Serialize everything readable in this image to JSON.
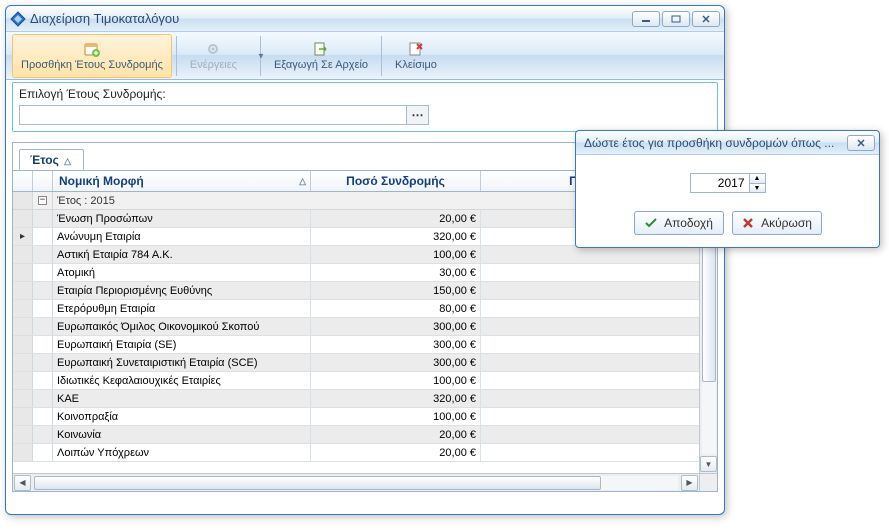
{
  "window": {
    "title": "Διαχείριση Τιμοκαταλόγου"
  },
  "toolbar": {
    "add_year": "Προσθήκη Έτους Συνδρομής",
    "actions": "Ενέργειες",
    "export": "Εξαγωγή Σε Αρχείο",
    "close": "Κλείσιμο"
  },
  "selection": {
    "label": "Επιλογή Έτους Συνδρομής:",
    "value": ""
  },
  "grid": {
    "group_tab": "Έτος",
    "headers": {
      "legal_form": "Νομική Μορφή",
      "fee": "Ποσό Συνδρομής",
      "liability_fee": "Ποσό Υπο"
    },
    "group_label": "Έτος : 2015",
    "rows": [
      {
        "name": "Ένωση Προσώπων",
        "fee": "20,00 €"
      },
      {
        "name": "Ανώνυμη Εταιρία",
        "fee": "320,00 €",
        "selected": true
      },
      {
        "name": "Αστική Εταιρία 784 Α.Κ.",
        "fee": "100,00 €"
      },
      {
        "name": "Ατομική",
        "fee": "30,00 €"
      },
      {
        "name": "Εταιρία Περιορισμένης Ευθύνης",
        "fee": "150,00 €"
      },
      {
        "name": "Ετερόρυθμη Εταιρία",
        "fee": "80,00 €"
      },
      {
        "name": "Ευρωπαικός Όμιλος Οικονομικού Σκοπού",
        "fee": "300,00 €"
      },
      {
        "name": "Ευρωπαική Εταιρία (SE)",
        "fee": "300,00 €"
      },
      {
        "name": "Ευρωπαική Συνεταιριστική Εταιρία (SCE)",
        "fee": "300,00 €"
      },
      {
        "name": "Ιδιωτικές Κεφαλαιουχικές Εταιρίες",
        "fee": "100,00 €"
      },
      {
        "name": "ΚΑΕ",
        "fee": "320,00 €"
      },
      {
        "name": "Κοινοπραξία",
        "fee": "100,00 €"
      },
      {
        "name": "Κοινωνία",
        "fee": "20,00 €"
      },
      {
        "name": "Λοιπών Υπόχρεων",
        "fee": "20,00 €"
      }
    ]
  },
  "dialog": {
    "title": "Δώστε έτος για προσθήκη συνδρομών όπως ...",
    "value": "2017",
    "accept": "Αποδοχή",
    "cancel": "Ακύρωση"
  }
}
